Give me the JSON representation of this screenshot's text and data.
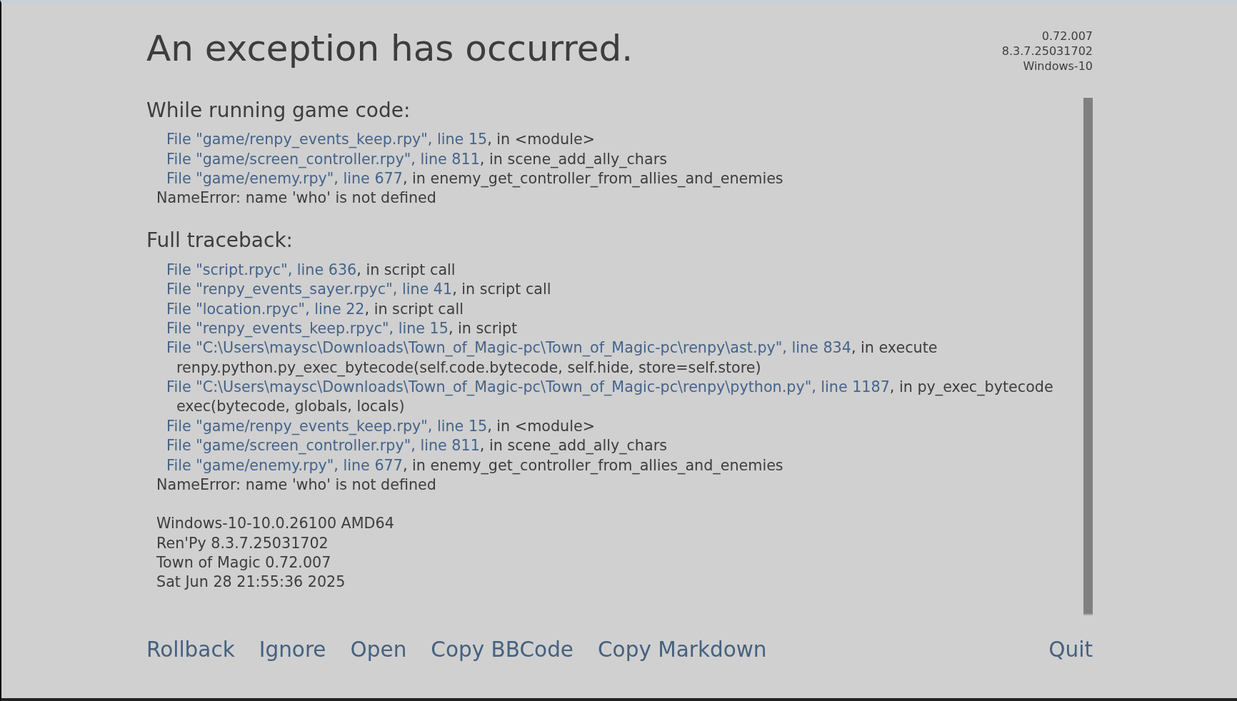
{
  "title": "An exception has occurred.",
  "version_info": [
    "0.72.007",
    "8.3.7.25031702",
    "Windows-10"
  ],
  "sections": [
    {
      "heading": "While running game code:",
      "lines": [
        {
          "kind": "frame",
          "location": "File \"game/renpy_events_keep.rpy\", line 15",
          "detail": ", in <module>"
        },
        {
          "kind": "frame",
          "location": "File \"game/screen_controller.rpy\", line 811",
          "detail": ", in scene_add_ally_chars"
        },
        {
          "kind": "frame",
          "location": "File \"game/enemy.rpy\", line 677",
          "detail": ", in enemy_get_controller_from_allies_and_enemies"
        },
        {
          "kind": "error",
          "text": "NameError: name 'who' is not defined"
        }
      ]
    },
    {
      "heading": "Full traceback:",
      "lines": [
        {
          "kind": "frame",
          "location": "File \"script.rpyc\", line 636",
          "detail": ", in script call"
        },
        {
          "kind": "frame",
          "location": "File \"renpy_events_sayer.rpyc\", line 41",
          "detail": ", in script call"
        },
        {
          "kind": "frame",
          "location": "File \"location.rpyc\", line 22",
          "detail": ", in script call"
        },
        {
          "kind": "frame",
          "location": "File \"renpy_events_keep.rpyc\", line 15",
          "detail": ", in script"
        },
        {
          "kind": "frame",
          "location": "File \"C:\\Users\\maysc\\Downloads\\Town_of_Magic-pc\\Town_of_Magic-pc\\renpy\\ast.py\", line 834",
          "detail": ", in execute"
        },
        {
          "kind": "code",
          "text": "renpy.python.py_exec_bytecode(self.code.bytecode, self.hide, store=self.store)"
        },
        {
          "kind": "frame",
          "location": "File \"C:\\Users\\maysc\\Downloads\\Town_of_Magic-pc\\Town_of_Magic-pc\\renpy\\python.py\", line 1187",
          "detail": ", in py_exec_bytecode"
        },
        {
          "kind": "code",
          "text": "exec(bytecode, globals, locals)"
        },
        {
          "kind": "frame",
          "location": "File \"game/renpy_events_keep.rpy\", line 15",
          "detail": ", in <module>"
        },
        {
          "kind": "frame",
          "location": "File \"game/screen_controller.rpy\", line 811",
          "detail": ", in scene_add_ally_chars"
        },
        {
          "kind": "frame",
          "location": "File \"game/enemy.rpy\", line 677",
          "detail": ", in enemy_get_controller_from_allies_and_enemies"
        },
        {
          "kind": "error",
          "text": "NameError: name 'who' is not defined"
        }
      ]
    }
  ],
  "system_info": [
    "Windows-10-10.0.26100 AMD64",
    "Ren'Py 8.3.7.25031702",
    "Town of Magic 0.72.007",
    "Sat Jun 28 21:55:36 2025"
  ],
  "buttons": [
    {
      "label": "Rollback"
    },
    {
      "label": "Ignore"
    },
    {
      "label": "Open"
    },
    {
      "label": "Copy BBCode"
    },
    {
      "label": "Copy Markdown"
    }
  ],
  "right_buttons": [
    {
      "label": "Quit"
    }
  ]
}
